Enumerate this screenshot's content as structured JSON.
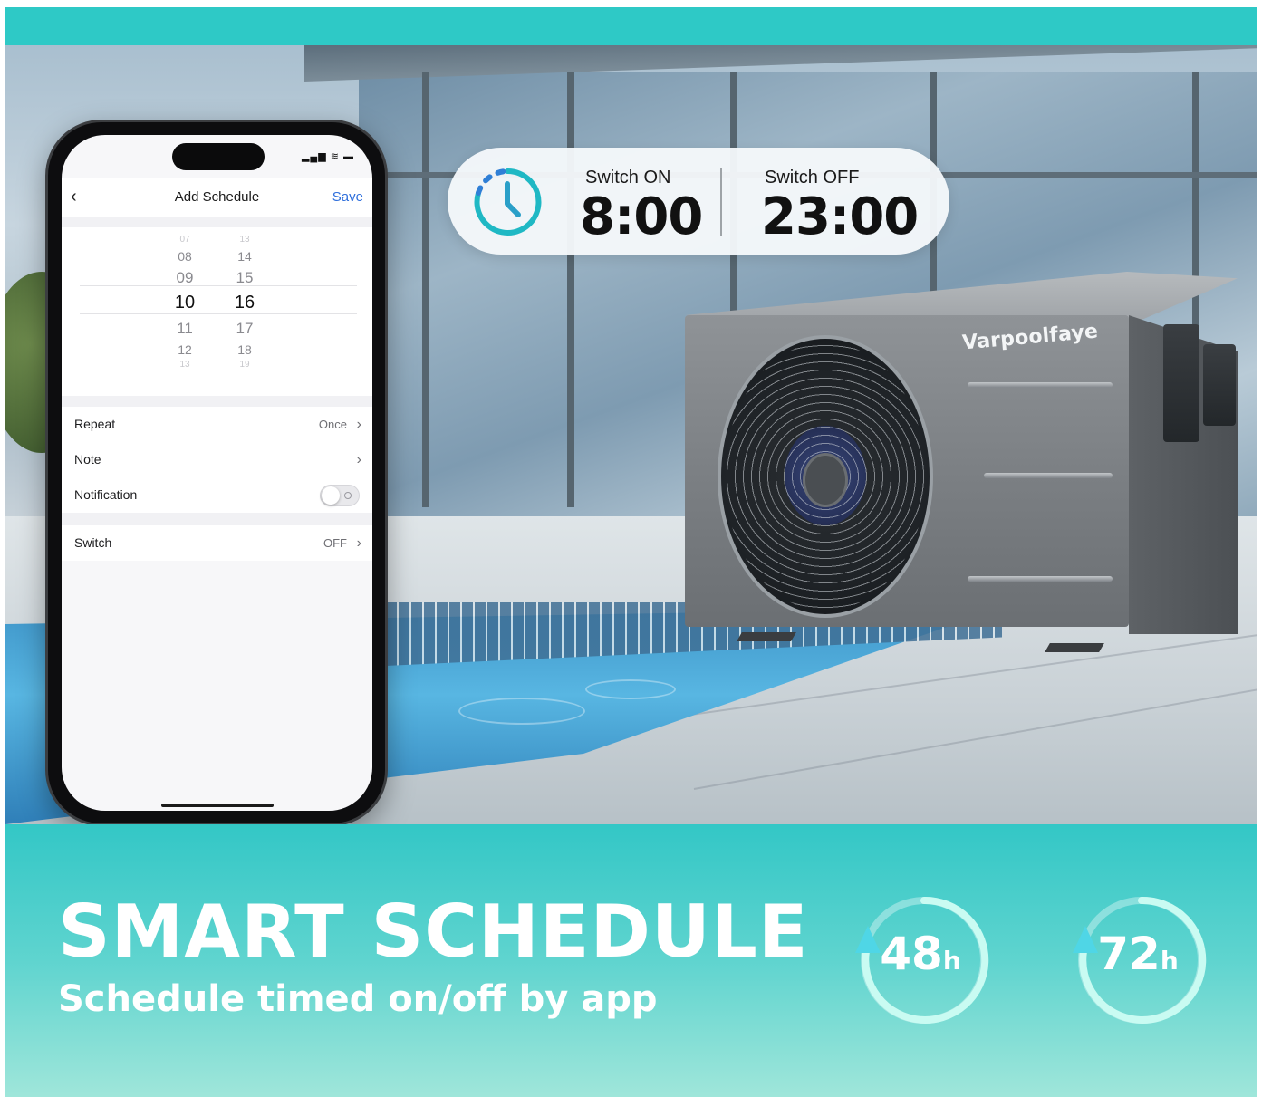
{
  "colors": {
    "accent_teal": "#2ec9c6",
    "save_blue": "#2f6fdc",
    "clock_teal": "#1fb8c4",
    "clock_blue": "#2f7fd6"
  },
  "phone": {
    "screen_title": "Add Schedule",
    "back_icon": "chevron-left-icon",
    "save_label": "Save",
    "picker": {
      "hours": [
        "07",
        "08",
        "09",
        "10",
        "11",
        "12",
        "13"
      ],
      "minutes": [
        "13",
        "14",
        "15",
        "16",
        "17",
        "18",
        "19"
      ],
      "selected_hour": "10",
      "selected_minute": "16"
    },
    "rows": {
      "repeat_label": "Repeat",
      "repeat_value": "Once",
      "note_label": "Note",
      "notification_label": "Notification",
      "notification_on": false,
      "switch_label": "Switch",
      "switch_value": "OFF"
    }
  },
  "schedule_card": {
    "icon": "clock-icon",
    "on_label": "Switch ON",
    "on_time": "8:00",
    "off_label": "Switch OFF",
    "off_time": "23:00"
  },
  "product": {
    "brand": "Varpoolfaye"
  },
  "banner": {
    "headline": "SMART SCHEDULE",
    "subline": "Schedule timed on/off by app",
    "badges": [
      {
        "value": "48",
        "unit": "h"
      },
      {
        "value": "72",
        "unit": "h"
      }
    ]
  }
}
